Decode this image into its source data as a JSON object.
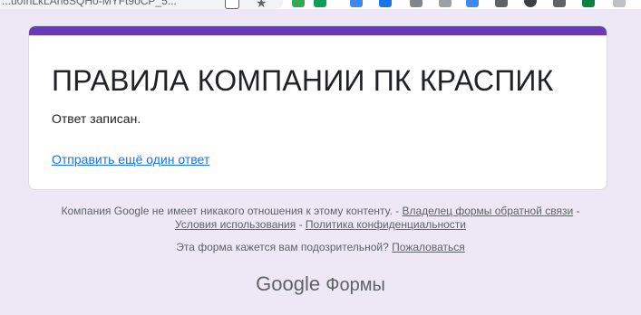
{
  "browser": {
    "url_fragment": "...u0fnLkLAh6SQHo-MYFt9oCP_5..."
  },
  "form": {
    "title": "ПРАВИЛА КОМПАНИИ ПК КРАСПИК",
    "response_message": "Ответ записан.",
    "submit_another_link": "Отправить ещё один ответ"
  },
  "footer": {
    "disclaimer": "Компания Google не имеет никакого отношения к этому контенту. -",
    "owner_link": "Владелец формы обратной связи",
    "sep1": "-",
    "terms_link": "Условия использования",
    "sep2": "-",
    "privacy_link": "Политика конфиденциальности",
    "suspicious_text": "Эта форма кажется вам подозрительной?",
    "report_link": "Пожаловаться"
  },
  "branding": {
    "google": "Google",
    "product": "Формы"
  },
  "colors": {
    "accent": "#673ab7",
    "background": "#ede7f6",
    "link": "#1a73e8"
  }
}
